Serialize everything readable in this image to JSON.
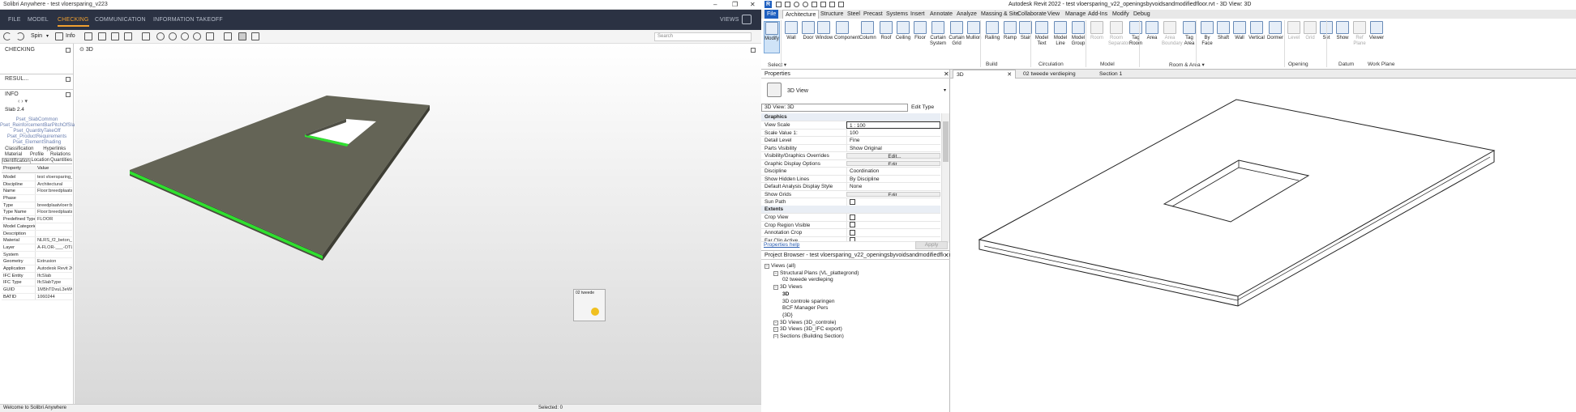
{
  "solibri": {
    "title": "Solibri Anywhere - test vloersparing_v223",
    "window_controls": [
      "–",
      "❐",
      "✕"
    ],
    "menu": [
      "FILE",
      "MODEL",
      "CHECKING",
      "COMMUNICATION",
      "INFORMATION TAKEOFF"
    ],
    "menu_active": "CHECKING",
    "views_label": "VIEWS",
    "toolbar": {
      "spin_label": "Spin",
      "info_label": "Info"
    },
    "search_placeholder": "Search",
    "checking_panel": "CHECKING",
    "results_panel": "RESUL...",
    "info_panel": "INFO",
    "selected_item": "Slab 2.4",
    "psets": [
      "Pset_SlabCommon",
      "Pset_ReinforcementBarPitchOfSlab",
      "Pset_QuantityTakeOff",
      "Pset_ProductRequirements",
      "Pset_ElementShading"
    ],
    "info_tabs_row1": [
      "Classification",
      "Hyperlinks"
    ],
    "info_tabs_row2": [
      "Material",
      "Profile",
      "Relations"
    ],
    "info_tabs_row3": [
      "Identification",
      "Location",
      "Quantities"
    ],
    "table_header": {
      "property": "Property",
      "value": "Value"
    },
    "properties": [
      [
        "Model",
        "test vloersparing_..."
      ],
      [
        "Discipline",
        "Architectural"
      ],
      [
        "Name",
        "Floor:breedplaats..."
      ],
      [
        "Phase",
        ""
      ],
      [
        "Type",
        "breedplaatvloer:bl..."
      ],
      [
        "Type Name",
        "Floor:breedplaats..."
      ],
      [
        "Predefined Type",
        "FLOOR"
      ],
      [
        "Model Categories",
        ""
      ],
      [
        "Description",
        ""
      ],
      [
        "Material",
        "NLRS_f2_beton_gr..."
      ],
      [
        "Layer",
        "A-FLOR-___-OTLN"
      ],
      [
        "System",
        ""
      ],
      [
        "Geometry",
        "Extrusion"
      ],
      [
        "Application",
        "Autodesk Revit 20..."
      ],
      [
        "IFC Entity",
        "IfcSlab"
      ],
      [
        "IFC Type",
        "IfcSlabType"
      ],
      [
        "GUID",
        "1M5hTDvuL3eWQ..."
      ],
      [
        "BATID",
        "1060244"
      ]
    ],
    "view_title": "3D",
    "minimap_label": "02 tweede",
    "status_left": "Welcome to Solibri Anywhere",
    "status_right": "Selected: 0"
  },
  "revit": {
    "title": "Autodesk Revit 2022 - test vloersparing_v22_openingsbyvoidsandmodifiedfloor.rvt - 3D View: 3D",
    "tabs": [
      "File",
      "Architecture",
      "Structure",
      "Steel",
      "Precast",
      "Systems",
      "Insert",
      "Annotate",
      "Analyze",
      "Massing & Site",
      "Collaborate",
      "View",
      "Manage",
      "Add-Ins",
      "Modify",
      "Debug"
    ],
    "active_tab": "Architecture",
    "ribbon_buttons": [
      [
        "Modify",
        ""
      ],
      [
        "Wall",
        ""
      ],
      [
        "Door",
        ""
      ],
      [
        "Window",
        ""
      ],
      [
        "Component",
        ""
      ],
      [
        "Column",
        ""
      ],
      [
        "Roof",
        ""
      ],
      [
        "Ceiling",
        ""
      ],
      [
        "Floor",
        ""
      ],
      [
        "Curtain",
        "System"
      ],
      [
        "Curtain",
        "Grid"
      ],
      [
        "Mullion",
        ""
      ],
      [
        "Railing",
        ""
      ],
      [
        "Ramp",
        ""
      ],
      [
        "Stair",
        ""
      ],
      [
        "Model",
        "Text"
      ],
      [
        "Model",
        "Line"
      ],
      [
        "Model",
        "Group"
      ],
      [
        "Room",
        ""
      ],
      [
        "Room",
        "Separator"
      ],
      [
        "Tag",
        "Room"
      ],
      [
        "Area",
        ""
      ],
      [
        "Area",
        "Boundary"
      ],
      [
        "Tag",
        "Area"
      ],
      [
        "By",
        "Face"
      ],
      [
        "Shaft",
        ""
      ],
      [
        "Wall",
        ""
      ],
      [
        "Vertical",
        ""
      ],
      [
        "Dormer",
        ""
      ],
      [
        "Level",
        ""
      ],
      [
        "Grid",
        ""
      ],
      [
        "Set",
        ""
      ],
      [
        "Show",
        ""
      ],
      [
        "Ref",
        "Plane"
      ],
      [
        "Viewer",
        ""
      ]
    ],
    "ribbon_groups": [
      "Select ▾",
      "Build",
      "Circulation",
      "Model",
      "Room & Area ▾",
      "Opening",
      "Datum",
      "Work Plane"
    ],
    "properties": {
      "header": "Properties",
      "type_name": "3D View",
      "instance_selector": "3D View: 3D",
      "edit_type": "Edit Type",
      "section_graphics": "Graphics",
      "rows": [
        [
          "View Scale",
          "1 : 100"
        ],
        [
          "Scale Value    1:",
          "100"
        ],
        [
          "Detail Level",
          "Fine"
        ],
        [
          "Parts Visibility",
          "Show Original"
        ],
        [
          "Visibility/Graphics Overrides",
          "Edit..."
        ],
        [
          "Graphic Display Options",
          "Edit..."
        ],
        [
          "Discipline",
          "Coordination"
        ],
        [
          "Show Hidden Lines",
          "By Discipline"
        ],
        [
          "Default Analysis Display Style",
          "None"
        ],
        [
          "Show Grids",
          "Edit..."
        ],
        [
          "Sun Path",
          ""
        ]
      ],
      "section_extents": "Extents",
      "extent_rows": [
        "Crop View",
        "Crop Region Visible",
        "Annotation Crop",
        "Far Clip Active"
      ],
      "help_link": "Properties help",
      "apply": "Apply"
    },
    "browser": {
      "header": "Project Browser - test vloersparing_v22_openingsbyvoidsandmodifiedfloor.rvt",
      "items": [
        [
          "Views (all)",
          0
        ],
        [
          "Structural Plans (VL_plattegrond)",
          1
        ],
        [
          "02 tweede verdieping",
          2
        ],
        [
          "3D Views",
          1
        ],
        [
          "3D",
          2
        ],
        [
          "3D controle sparingen",
          2
        ],
        [
          "BCF Manager Pers",
          2
        ],
        [
          "{3D}",
          2
        ],
        [
          "3D Views (3D_controle)",
          1
        ],
        [
          "3D Views (3D_IFC export)",
          1
        ],
        [
          "Sections (Building Section)",
          1
        ]
      ]
    },
    "view_tabs": [
      "3D",
      "02 tweede verdieping",
      "Section 1"
    ]
  }
}
